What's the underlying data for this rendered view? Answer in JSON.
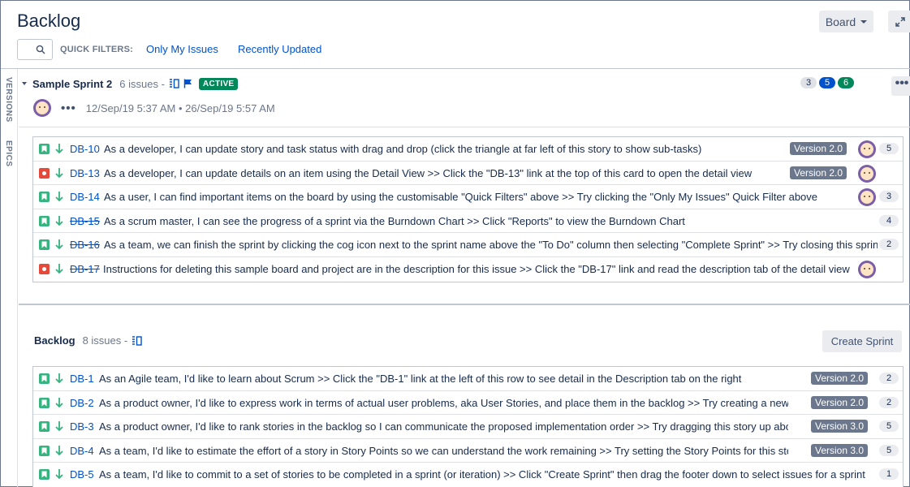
{
  "header": {
    "title": "Backlog",
    "board_label": "Board",
    "quick_filters_label": "QUICK FILTERS:",
    "filters": [
      "Only My Issues",
      "Recently Updated"
    ]
  },
  "side_tabs": [
    "VERSIONS",
    "EPICS"
  ],
  "sprint": {
    "name": "Sample Sprint 2",
    "issue_count": "6 issues",
    "separator": "-",
    "status": "ACTIVE",
    "counts": [
      {
        "value": "3",
        "color": "#dfe1e6",
        "text": "#172b4d"
      },
      {
        "value": "5",
        "color": "#0052cc",
        "text": "#ffffff"
      },
      {
        "value": "6",
        "color": "#00875a",
        "text": "#ffffff"
      }
    ],
    "more": "•••",
    "dates": "12/Sep/19 5:37 AM • 26/Sep/19 5:57 AM",
    "issues": [
      {
        "type": "story",
        "key": "DB-10",
        "done": false,
        "summary": "As a developer, I can update story and task status with drag and drop (click the triangle at far left of this story to show sub-tasks)",
        "version": "Version 2.0",
        "avatar": true,
        "points": "5"
      },
      {
        "type": "bug",
        "key": "DB-13",
        "done": false,
        "summary": "As a developer, I can update details on an item using the Detail View >> Click the \"DB-13\" link at the top of this card to open the detail view",
        "version": "Version 2.0",
        "avatar": true,
        "points": ""
      },
      {
        "type": "story",
        "key": "DB-14",
        "done": false,
        "summary": "As a user, I can find important items on the board by using the customisable \"Quick Filters\" above >> Try clicking the \"Only My Issues\" Quick Filter above",
        "version": "",
        "avatar": true,
        "points": "3"
      },
      {
        "type": "story",
        "key": "DB-15",
        "done": true,
        "summary": "As a scrum master, I can see the progress of a sprint via the Burndown Chart >> Click \"Reports\" to view the Burndown Chart",
        "version": "",
        "avatar": false,
        "points": "4"
      },
      {
        "type": "story",
        "key": "DB-16",
        "done": true,
        "summary": "As a team, we can finish the sprint by clicking the cog icon next to the sprint name above the \"To Do\" column then selecting \"Complete Sprint\" >> Try closing this sprint now",
        "version": "",
        "avatar": false,
        "points": "2"
      },
      {
        "type": "bug",
        "key": "DB-17",
        "done": true,
        "summary": "Instructions for deleting this sample board and project are in the description for this issue >> Click the \"DB-17\" link and read the description tab of the detail view",
        "version": "",
        "avatar": true,
        "points": ""
      }
    ]
  },
  "backlog": {
    "name": "Backlog",
    "issue_count": "8 issues",
    "separator": "-",
    "create_label": "Create Sprint",
    "issues": [
      {
        "type": "story",
        "key": "DB-1",
        "done": false,
        "summary": "As an Agile team, I'd like to learn about Scrum >> Click the \"DB-1\" link at the left of this row to see detail in the Description tab on the right",
        "version": "Version 2.0",
        "avatar": false,
        "points": "2"
      },
      {
        "type": "story",
        "key": "DB-2",
        "done": false,
        "summary": "As a product owner, I'd like to express work in terms of actual user problems, aka User Stories, and place them in the backlog >> Try creating a new story",
        "version": "Version 2.0",
        "avatar": false,
        "points": "2"
      },
      {
        "type": "story",
        "key": "DB-3",
        "done": false,
        "summary": "As a product owner, I'd like to rank stories in the backlog so I can communicate the proposed implementation order >> Try dragging this story up above the previous story",
        "version": "Version 3.0",
        "avatar": false,
        "points": "5"
      },
      {
        "type": "story",
        "key": "DB-4",
        "done": false,
        "summary": "As a team, I'd like to estimate the effort of a story in Story Points so we can understand the work remaining >> Try setting the Story Points for this story",
        "version": "Version 3.0",
        "avatar": false,
        "points": "5"
      },
      {
        "type": "story",
        "key": "DB-5",
        "done": false,
        "summary": "As a team, I'd like to commit to a set of stories to be completed in a sprint (or iteration) >> Click \"Create Sprint\" then drag the footer down to select issues for a sprint",
        "version": "",
        "avatar": false,
        "points": "1"
      }
    ]
  }
}
